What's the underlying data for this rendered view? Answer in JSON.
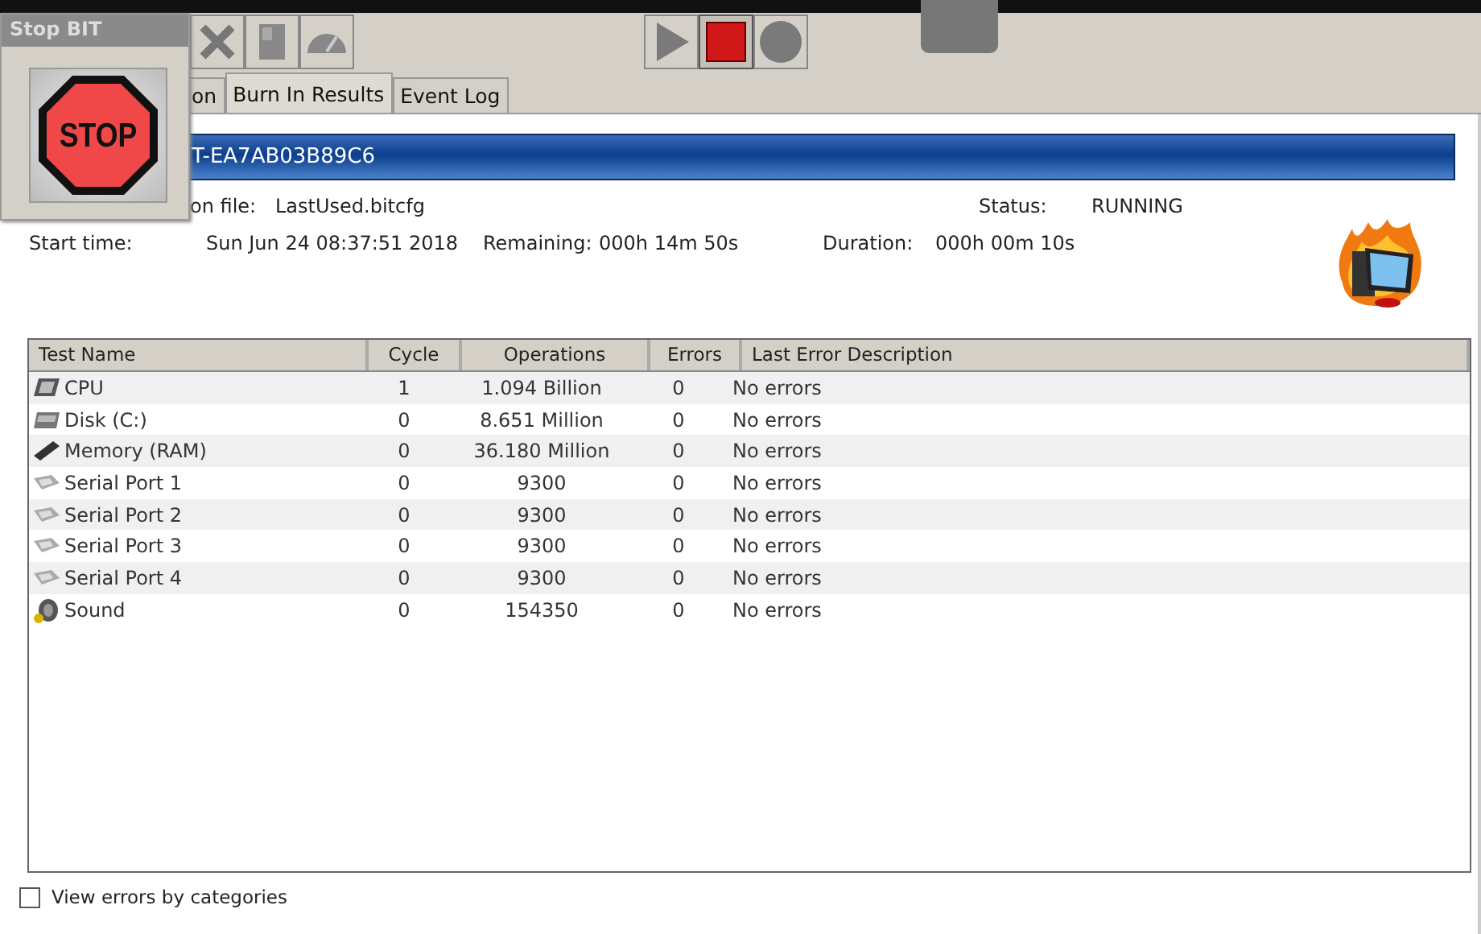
{
  "stop_window": {
    "title": "Stop BIT",
    "stop_label": "STOP"
  },
  "toolbar": {
    "left_buttons": [
      {
        "kind": "close"
      },
      {
        "kind": "door"
      },
      {
        "kind": "gauge"
      }
    ],
    "run_buttons": [
      {
        "kind": "play",
        "selected": false
      },
      {
        "kind": "stop",
        "selected": true
      },
      {
        "kind": "record",
        "selected": false
      }
    ]
  },
  "tabs": [
    {
      "label": "on",
      "selected": false
    },
    {
      "label": "Burn In Results",
      "selected": true
    },
    {
      "label": "Event Log",
      "selected": false
    }
  ],
  "machine_bar": {
    "text": "T-EA7AB03B89C6"
  },
  "info": {
    "config_label": "on file:",
    "config_value": "LastUsed.bitcfg",
    "start_label": "Start time:",
    "start_value": "Sun Jun 24 08:37:51 2018",
    "remaining_label": "Remaining:",
    "remaining_value": "000h 14m 50s",
    "status_label": "Status:",
    "status_value": "RUNNING",
    "duration_label": "Duration:",
    "duration_value": "000h 00m 10s"
  },
  "table": {
    "columns": [
      "Test Name",
      "Cycle",
      "Operations",
      "Errors",
      "Last Error Description"
    ],
    "rows": [
      {
        "kind": "cpu",
        "name": "CPU",
        "cycle": "1",
        "operations": "1.094 Billion",
        "errors": "0",
        "description": "No errors"
      },
      {
        "kind": "disk",
        "name": "Disk (C:)",
        "cycle": "0",
        "operations": "8.651 Million",
        "errors": "0",
        "description": "No errors"
      },
      {
        "kind": "memory",
        "name": "Memory (RAM)",
        "cycle": "0",
        "operations": "36.180 Million",
        "errors": "0",
        "description": "No errors"
      },
      {
        "kind": "serial",
        "name": "Serial Port 1",
        "cycle": "0",
        "operations": "9300",
        "errors": "0",
        "description": "No errors"
      },
      {
        "kind": "serial",
        "name": "Serial Port 2",
        "cycle": "0",
        "operations": "9300",
        "errors": "0",
        "description": "No errors"
      },
      {
        "kind": "serial",
        "name": "Serial Port 3",
        "cycle": "0",
        "operations": "9300",
        "errors": "0",
        "description": "No errors"
      },
      {
        "kind": "serial",
        "name": "Serial Port 4",
        "cycle": "0",
        "operations": "9300",
        "errors": "0",
        "description": "No errors"
      },
      {
        "kind": "sound",
        "name": "Sound",
        "cycle": "0",
        "operations": "154350",
        "errors": "0",
        "description": "No errors"
      }
    ]
  },
  "view_errors": {
    "label": "View errors by categories",
    "checked": false
  }
}
